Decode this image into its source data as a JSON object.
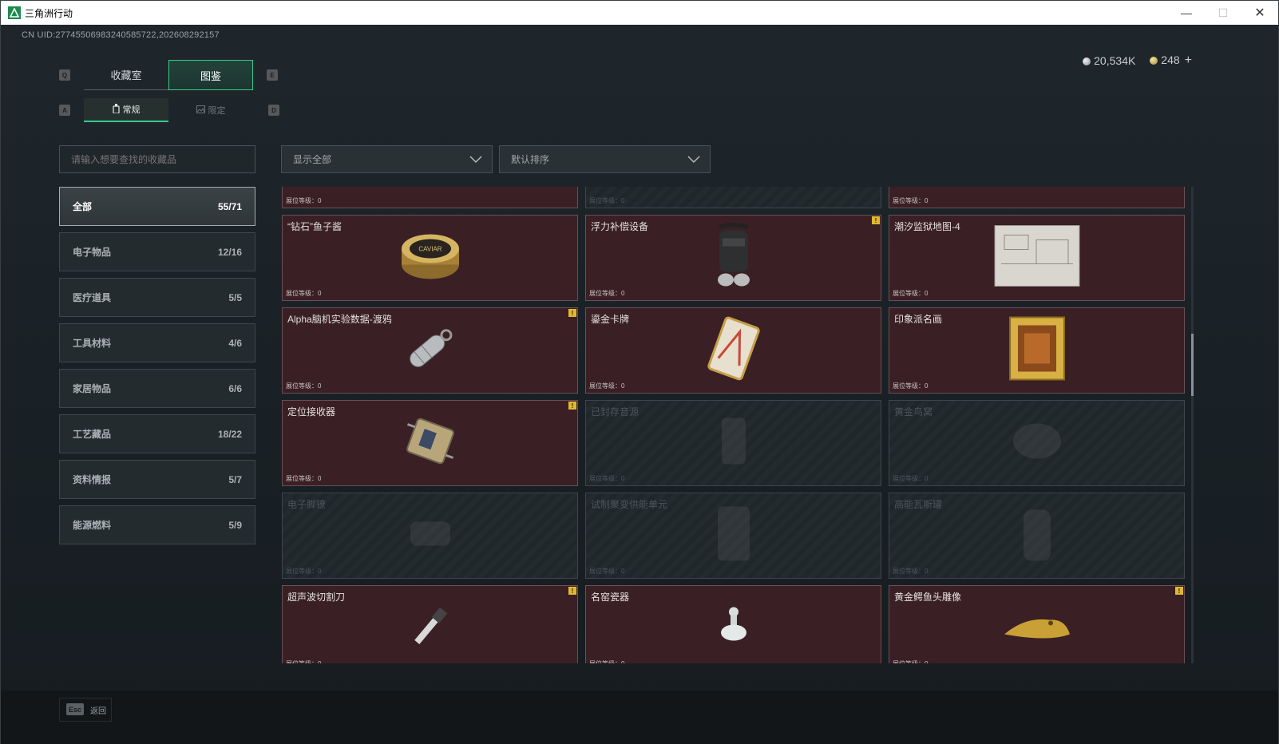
{
  "window": {
    "title": "三角洲行动",
    "min": "—",
    "max": "☐",
    "close": "✕"
  },
  "uid": "CN UID:2774550698324058572​2,202608292157",
  "currency": {
    "silver": "20,534K",
    "gold": "248",
    "plus": "+"
  },
  "keys": {
    "tab_prev": "Q",
    "tab_next": "E",
    "sub_prev": "A",
    "sub_next": "D"
  },
  "tabs": [
    {
      "label": "收藏室",
      "active": false
    },
    {
      "label": "图鉴",
      "active": true
    }
  ],
  "subtabs": [
    {
      "label": "常规",
      "icon": "bottle-icon",
      "active": true
    },
    {
      "label": "限定",
      "icon": "picture-icon",
      "active": false
    }
  ],
  "search": {
    "placeholder": "请输入想要查找的收藏品"
  },
  "filters": {
    "show": "显示全部",
    "sort": "默认排序"
  },
  "categories": [
    {
      "label": "全部",
      "count": "55/71",
      "active": true
    },
    {
      "label": "电子物品",
      "count": "12/16"
    },
    {
      "label": "医疗道具",
      "count": "5/5"
    },
    {
      "label": "工具材料",
      "count": "4/6"
    },
    {
      "label": "家居物品",
      "count": "6/6"
    },
    {
      "label": "工艺藏品",
      "count": "18/22"
    },
    {
      "label": "资料情报",
      "count": "5/7"
    },
    {
      "label": "能源燃料",
      "count": "5/9"
    }
  ],
  "level_label": "展位等级：0",
  "items": [
    {
      "name": "",
      "owned": true,
      "alert": false,
      "icon": "armillary-sphere-icon"
    },
    {
      "name": "",
      "owned": false,
      "alert": false,
      "icon": "chessboard-icon"
    },
    {
      "name": "",
      "owned": true,
      "alert": false,
      "icon": "machine-icon"
    },
    {
      "name": "“钻石”鱼子酱",
      "owned": true,
      "alert": false,
      "icon": "caviar-tin-icon"
    },
    {
      "name": "浮力补偿设备",
      "owned": true,
      "alert": true,
      "icon": "buoyancy-device-icon"
    },
    {
      "name": "潮汐监狱地图-4",
      "owned": true,
      "alert": false,
      "icon": "map-icon"
    },
    {
      "name": "Alpha脑机实验数据-渡鸦",
      "owned": true,
      "alert": true,
      "icon": "data-capsule-icon"
    },
    {
      "name": "鎏金卡牌",
      "owned": true,
      "alert": false,
      "icon": "gilded-card-icon"
    },
    {
      "name": "印象派名画",
      "owned": true,
      "alert": false,
      "icon": "framed-painting-icon"
    },
    {
      "name": "定位接收器",
      "owned": true,
      "alert": true,
      "icon": "receiver-icon"
    },
    {
      "name": "已封存音源",
      "owned": false,
      "alert": false,
      "icon": "audio-source-icon"
    },
    {
      "name": "黄金鸟窝",
      "owned": false,
      "alert": false,
      "icon": "golden-nest-icon"
    },
    {
      "name": "电子脚镣",
      "owned": false,
      "alert": false,
      "icon": "ankle-monitor-icon"
    },
    {
      "name": "试制聚变供能单元",
      "owned": false,
      "alert": false,
      "icon": "fusion-unit-icon"
    },
    {
      "name": "高能瓦斯罐",
      "owned": false,
      "alert": false,
      "icon": "gas-canister-icon"
    },
    {
      "name": "超声波切割刀",
      "owned": true,
      "alert": true,
      "icon": "ultrasonic-knife-icon"
    },
    {
      "name": "名窑瓷器",
      "owned": true,
      "alert": false,
      "icon": "porcelain-icon"
    },
    {
      "name": "黄金鳄鱼头雕像",
      "owned": true,
      "alert": true,
      "icon": "gold-croc-head-icon"
    }
  ],
  "alert_mark": "!",
  "footer": {
    "esc": "Esc",
    "back": "返回"
  }
}
